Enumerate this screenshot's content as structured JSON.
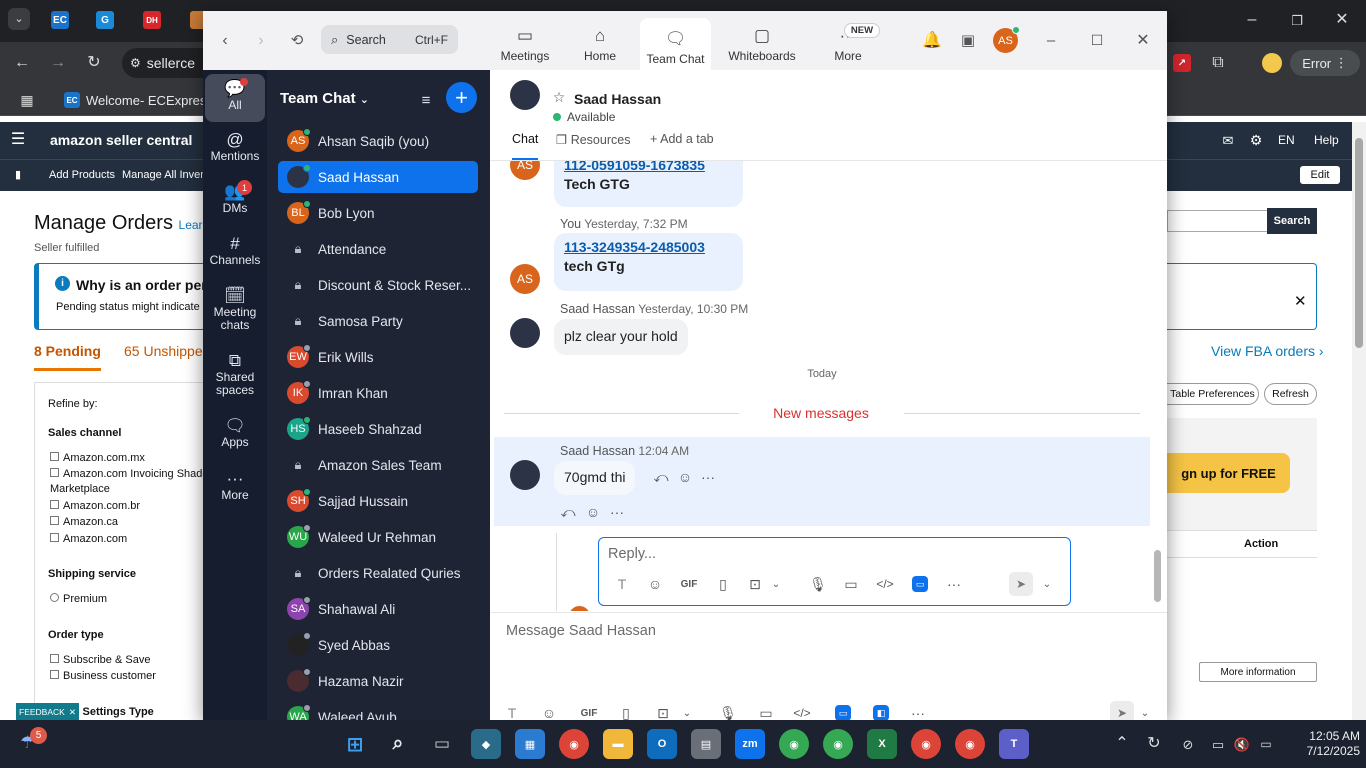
{
  "browser": {
    "bookmarks": [
      {
        "label": "Welcome- ECExpres..."
      }
    ],
    "tab_icons": [
      "EC",
      "G",
      "DH"
    ],
    "address_text": "sellerce",
    "profile_status": "Error"
  },
  "amazon": {
    "brand": "amazon seller central",
    "nav_right": {
      "lang": "EN",
      "help": "Help"
    },
    "subnav": [
      "Add Products",
      "Manage All Invent"
    ],
    "edit_label": "Edit",
    "page_title": "Manage Orders",
    "learn_link": "Lear",
    "subtitle": "Seller fulfilled",
    "info_title": "Why is an order pen",
    "info_body": "Pending status might indicate",
    "tabs": {
      "pending": "8 Pending",
      "unshipped": "65 Unshippe"
    },
    "refine": "Refine by:",
    "sales_channel": {
      "title": "Sales channel",
      "options": [
        "Amazon.com.mx",
        "Amazon.com Invoicing Shado",
        "Marketplace",
        "Amazon.com.br",
        "Amazon.ca",
        "Amazon.com"
      ]
    },
    "shipping": {
      "title": "Shipping service",
      "options": [
        "Premium"
      ]
    },
    "order_type": {
      "title": "Order type",
      "options": [
        "Subscribe & Save",
        "Business customer"
      ]
    },
    "settings_type": "ng Settings Type",
    "feedback": "FEEDBACK",
    "search_btn": "Search",
    "view_fba": "View FBA orders",
    "table_pref": "Table Preferences",
    "refresh": "Refresh",
    "signup": "gn up for FREE",
    "action_col": "Action",
    "more_info": "More information"
  },
  "zoom": {
    "search": {
      "label": "Search",
      "shortcut": "Ctrl+F"
    },
    "nav_tabs": [
      {
        "label": "Meetings",
        "icon": "video-icon"
      },
      {
        "label": "Home",
        "icon": "home-icon"
      },
      {
        "label": "Team Chat",
        "icon": "chat-icon"
      },
      {
        "label": "Whiteboards",
        "icon": "whiteboard-icon"
      },
      {
        "label": "More",
        "icon": "more-icon",
        "badge": "NEW"
      }
    ],
    "user_initials": "AS",
    "rail": [
      {
        "label": "All"
      },
      {
        "label": "Mentions"
      },
      {
        "label": "DMs",
        "badge": "1"
      },
      {
        "label": "Channels"
      },
      {
        "label": "Meeting chats"
      },
      {
        "label": "Shared spaces"
      },
      {
        "label": "Apps"
      },
      {
        "label": "More"
      }
    ],
    "list_header": "Team Chat",
    "chats": [
      {
        "name": "Ahsan Saqib (you)",
        "initials": "AS",
        "color": "#d9651c",
        "status": "#2bb673",
        "type": "user"
      },
      {
        "name": "Saad Hassan",
        "initials": "",
        "color": "#2c3347",
        "status": "#2bb673",
        "type": "photo",
        "active": true
      },
      {
        "name": "Bob Lyon",
        "initials": "BL",
        "color": "#d9651c",
        "status": "#2bb673",
        "type": "user"
      },
      {
        "name": "Attendance",
        "type": "channel"
      },
      {
        "name": "Discount & Stock Reser...",
        "type": "channel"
      },
      {
        "name": "Samosa Party",
        "type": "channel"
      },
      {
        "name": "Erik Wills",
        "initials": "EW",
        "color": "#d94a2e",
        "status": "#9aa0aa",
        "type": "user"
      },
      {
        "name": "Imran Khan",
        "initials": "IK",
        "color": "#d94a2e",
        "status": "#9aa0aa",
        "type": "user"
      },
      {
        "name": "Haseeb Shahzad",
        "initials": "HS",
        "color": "#1aa58a",
        "status": "#2bb673",
        "type": "user"
      },
      {
        "name": "Amazon Sales Team",
        "type": "channel"
      },
      {
        "name": "Sajjad Hussain",
        "initials": "SH",
        "color": "#d94a2e",
        "status": "#2bb673",
        "type": "user"
      },
      {
        "name": "Waleed Ur Rehman",
        "initials": "WU",
        "color": "#2aa64a",
        "status": "#9aa0aa",
        "type": "user"
      },
      {
        "name": "Orders Realated Quries",
        "type": "channel"
      },
      {
        "name": "Shahawal Ali",
        "initials": "SA",
        "color": "#8e44ad",
        "status": "#9aa0aa",
        "type": "user"
      },
      {
        "name": "Syed Abbas",
        "initials": "",
        "color": "#222222",
        "status": "#9aa0aa",
        "type": "photo"
      },
      {
        "name": "Hazama Nazir",
        "initials": "",
        "color": "#4a2c30",
        "status": "#9aa0aa",
        "type": "photo"
      },
      {
        "name": "Waleed Ayub",
        "initials": "WA",
        "color": "#2aa64a",
        "status": "#9aa0aa",
        "type": "user"
      }
    ],
    "chat_header": {
      "name": "Saad Hassan",
      "status": "Available"
    },
    "chat_tabs": [
      "Chat",
      "Resources",
      "Add a tab"
    ],
    "messages": {
      "m1": {
        "initials": "AS",
        "link": "112-0591059-1673835",
        "text": "Tech GTG"
      },
      "m2": {
        "sender": "You",
        "time": "Yesterday, 7:32 PM",
        "initials": "AS",
        "link": "113-3249354-2485003",
        "text": "tech GTg"
      },
      "m3": {
        "sender": "Saad Hassan",
        "time": "Yesterday, 10:30 PM",
        "text": "plz clear your hold"
      },
      "today": "Today",
      "new_messages": "New messages",
      "m4": {
        "sender": "Saad Hassan",
        "time": "12:04 AM",
        "text": "70gmd thi"
      }
    },
    "reply": {
      "placeholder": "Reply...",
      "initials": "AS"
    },
    "composer": {
      "placeholder": "Message Saad Hassan"
    }
  },
  "taskbar": {
    "weather_badge": "5",
    "time": "12:05 AM",
    "date": "7/12/2025",
    "apps": [
      "windows",
      "search",
      "taskview",
      "app1",
      "store",
      "chrome",
      "explorer",
      "outlook",
      "calculator",
      "zoom",
      "chrome2",
      "chrome3",
      "excel",
      "chrome4",
      "chrome5",
      "teams"
    ]
  },
  "colors": {
    "zoom_blue": "#0e72ed",
    "rail_bg": "#161d2f",
    "list_bg": "#1f2434",
    "new_messages": "#d9322e",
    "link": "#0b5cad",
    "amazon_nav": "#232f3e"
  }
}
